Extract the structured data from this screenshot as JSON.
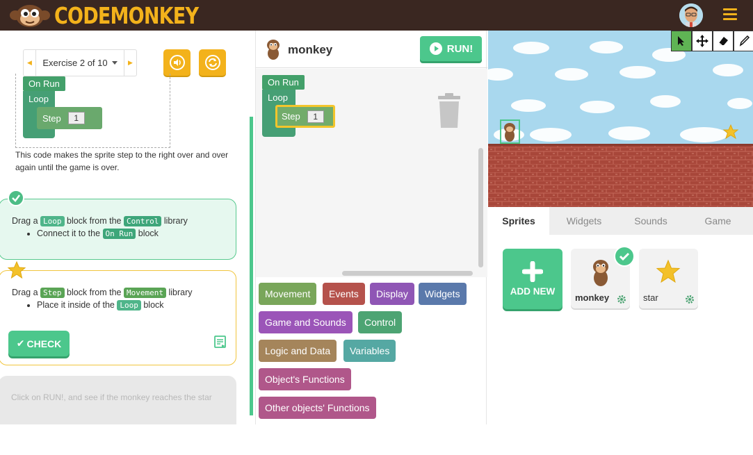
{
  "brand": {
    "name": "CODEMONKEY"
  },
  "exercise": {
    "label": "Exercise 2 of 10"
  },
  "example_code": {
    "on_run": "On Run",
    "loop": "Loop",
    "step": "Step",
    "step_value": "1"
  },
  "description": "This code makes the sprite step to the right over and over again until the game is over.",
  "tasks": [
    {
      "text_prefix": "Drag a",
      "chip": "Loop",
      "text_mid": "block from the",
      "chip2": "Control",
      "text_suffix": "library",
      "sub_prefix": "Connect it to the",
      "sub_chip": "On Run",
      "sub_suffix": "block"
    },
    {
      "text_prefix": "Drag a",
      "chip": "Step",
      "text_mid": "block from the",
      "chip2": "Movement",
      "text_suffix": "library",
      "sub_prefix": "Place it inside of the",
      "sub_chip": "Loop",
      "sub_suffix": "block"
    }
  ],
  "check_button": "CHECK",
  "hint": "Click on RUN!, and see if the monkey reaches the star",
  "editor": {
    "sprite_name": "monkey",
    "run_label": "RUN!",
    "code": {
      "on_run": "On Run",
      "loop": "Loop",
      "step": "Step",
      "step_value": "1"
    }
  },
  "categories": [
    {
      "label": "Movement",
      "color": "#79a65a"
    },
    {
      "label": "Events",
      "color": "#b5524c"
    },
    {
      "label": "Display",
      "color": "#8f56b5"
    },
    {
      "label": "Widgets",
      "color": "#5a79ab"
    },
    {
      "label": "Game and Sounds",
      "color": "#9b55b8"
    },
    {
      "label": "Control",
      "color": "#4da473"
    },
    {
      "label": "Logic and Data",
      "color": "#a5855b"
    },
    {
      "label": "Variables",
      "color": "#55a8a3"
    },
    {
      "label": "Object's Functions",
      "color": "#b0578a"
    },
    {
      "label": "Other objects' Functions",
      "color": "#b0578a"
    }
  ],
  "right_tabs": [
    "Sprites",
    "Widgets",
    "Sounds",
    "Game"
  ],
  "add_new": "ADD NEW",
  "sprites": [
    {
      "name": "monkey",
      "selected": true
    },
    {
      "name": "star",
      "selected": false
    }
  ],
  "colors": {
    "topbar": "#3a2721",
    "accent": "#4cc78c",
    "brand_yellow": "#f3b21b"
  }
}
